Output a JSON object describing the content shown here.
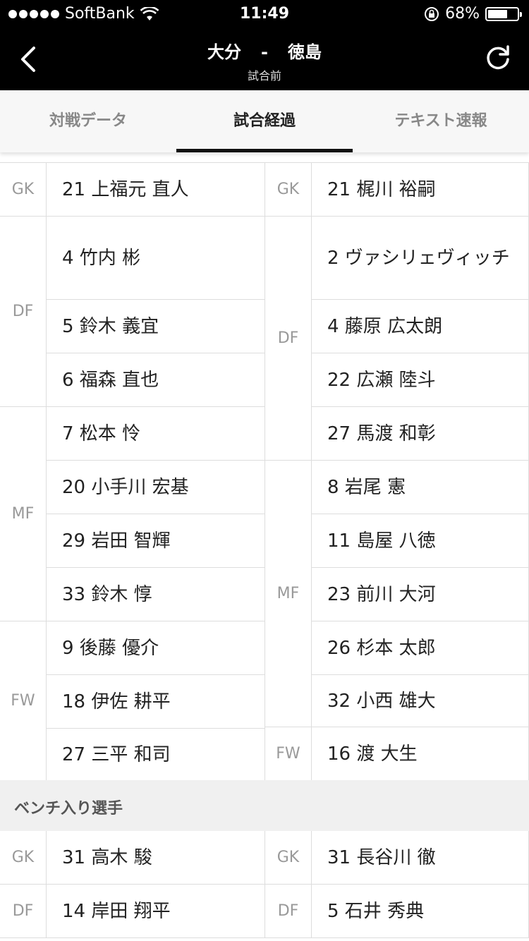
{
  "status_bar": {
    "carrier": "SoftBank",
    "time": "11:49",
    "battery": "68%",
    "battery_level": 0.68
  },
  "nav": {
    "home": "大分",
    "separator": "-",
    "away": "徳島",
    "subtitle": "試合前"
  },
  "tabs": [
    {
      "label": "対戦データ",
      "active": false
    },
    {
      "label": "試合経過",
      "active": true
    },
    {
      "label": "テキスト速報",
      "active": false
    }
  ],
  "lineup": {
    "home_positions": [
      "GK",
      "DF",
      "MF",
      "FW"
    ],
    "away_positions": [
      "GK",
      "DF",
      "MF",
      "FW"
    ],
    "home_players": [
      "21 上福元 直人",
      "4 竹内 彬",
      "5 鈴木 義宜",
      "6 福森 直也",
      "7 松本 怜",
      "20 小手川 宏基",
      "29 岩田 智輝",
      "33 鈴木 惇",
      "9 後藤 優介",
      "18 伊佐 耕平",
      "27 三平 和司"
    ],
    "away_players": [
      "21 梶川 裕嗣",
      "2 ヴァシリェヴィッチ",
      "4 藤原 広太朗",
      "22 広瀬 陸斗",
      "27 馬渡 和彰",
      "8 岩尾 憲",
      "11 島屋 八徳",
      "23 前川 大河",
      "26 杉本 太郎",
      "32 小西 雄大",
      "16 渡 大生"
    ]
  },
  "bench": {
    "title": "ベンチ入り選手",
    "home_positions": [
      "GK",
      "DF"
    ],
    "away_positions": [
      "GK",
      "DF"
    ],
    "home_players": [
      "31 高木 駿",
      "14 岸田 翔平"
    ],
    "away_players": [
      "31 長谷川 徹",
      "5 石井 秀典"
    ]
  }
}
